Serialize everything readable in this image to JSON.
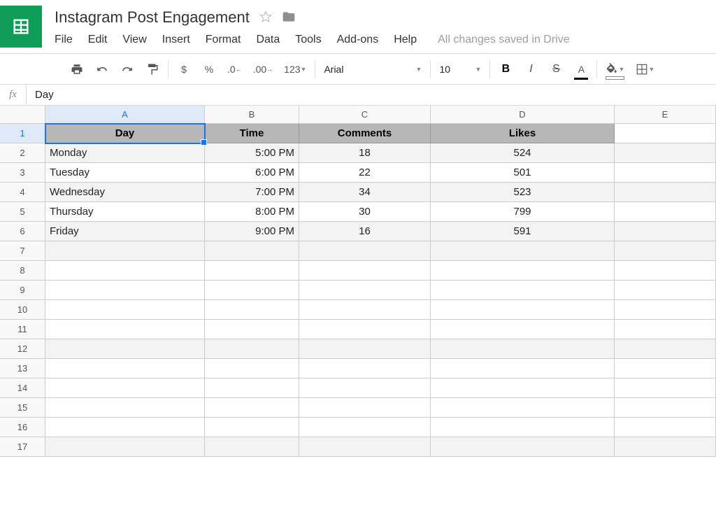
{
  "doc_title": "Instagram Post Engagement",
  "save_status": "All changes saved in Drive",
  "menu": [
    "File",
    "Edit",
    "View",
    "Insert",
    "Format",
    "Data",
    "Tools",
    "Add-ons",
    "Help"
  ],
  "toolbar": {
    "currency": "$",
    "percent": "%",
    "dec_less": ".0",
    "dec_more": ".00",
    "more_fmt": "123",
    "font": "Arial",
    "size": "10",
    "bold": "B",
    "italic": "I",
    "strike": "S",
    "text_color": "A"
  },
  "formula": {
    "fx": "fx",
    "value": "Day"
  },
  "columns": [
    "A",
    "B",
    "C",
    "D",
    "E"
  ],
  "active_col": "A",
  "active_row": "1",
  "row_count": 17,
  "sheet": {
    "headers": [
      "Day",
      "Time",
      "Comments",
      "Likes"
    ],
    "rows": [
      {
        "day": "Monday",
        "time": "5:00 PM",
        "comments": "18",
        "likes": "524"
      },
      {
        "day": "Tuesday",
        "time": "6:00 PM",
        "comments": "22",
        "likes": "501"
      },
      {
        "day": "Wednesday",
        "time": "7:00 PM",
        "comments": "34",
        "likes": "523"
      },
      {
        "day": "Thursday",
        "time": "8:00 PM",
        "comments": "30",
        "likes": "799"
      },
      {
        "day": "Friday",
        "time": "9:00 PM",
        "comments": "16",
        "likes": "591"
      }
    ]
  },
  "chart_data": {
    "type": "table",
    "title": "Instagram Post Engagement",
    "columns": [
      "Day",
      "Time",
      "Comments",
      "Likes"
    ],
    "rows": [
      [
        "Monday",
        "5:00 PM",
        18,
        524
      ],
      [
        "Tuesday",
        "6:00 PM",
        22,
        501
      ],
      [
        "Wednesday",
        "7:00 PM",
        34,
        523
      ],
      [
        "Thursday",
        "8:00 PM",
        30,
        799
      ],
      [
        "Friday",
        "9:00 PM",
        16,
        591
      ]
    ]
  }
}
